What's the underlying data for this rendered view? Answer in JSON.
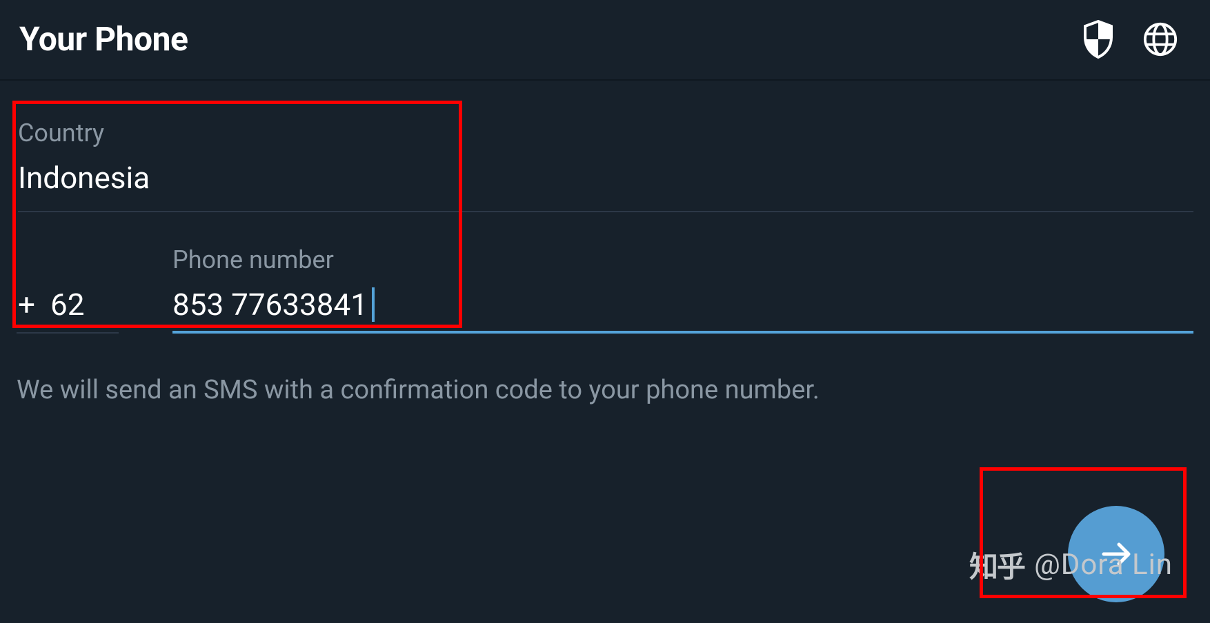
{
  "header": {
    "title": "Your Phone"
  },
  "country": {
    "label": "Country",
    "value": "Indonesia"
  },
  "phone": {
    "label": "Phone number",
    "code_prefix": "+",
    "code": "62",
    "value": "853 77633841"
  },
  "info_text": "We will send an SMS with a confirmation code to your phone number.",
  "watermark": {
    "zhihu": "知乎",
    "author": "@Dora Lin"
  }
}
